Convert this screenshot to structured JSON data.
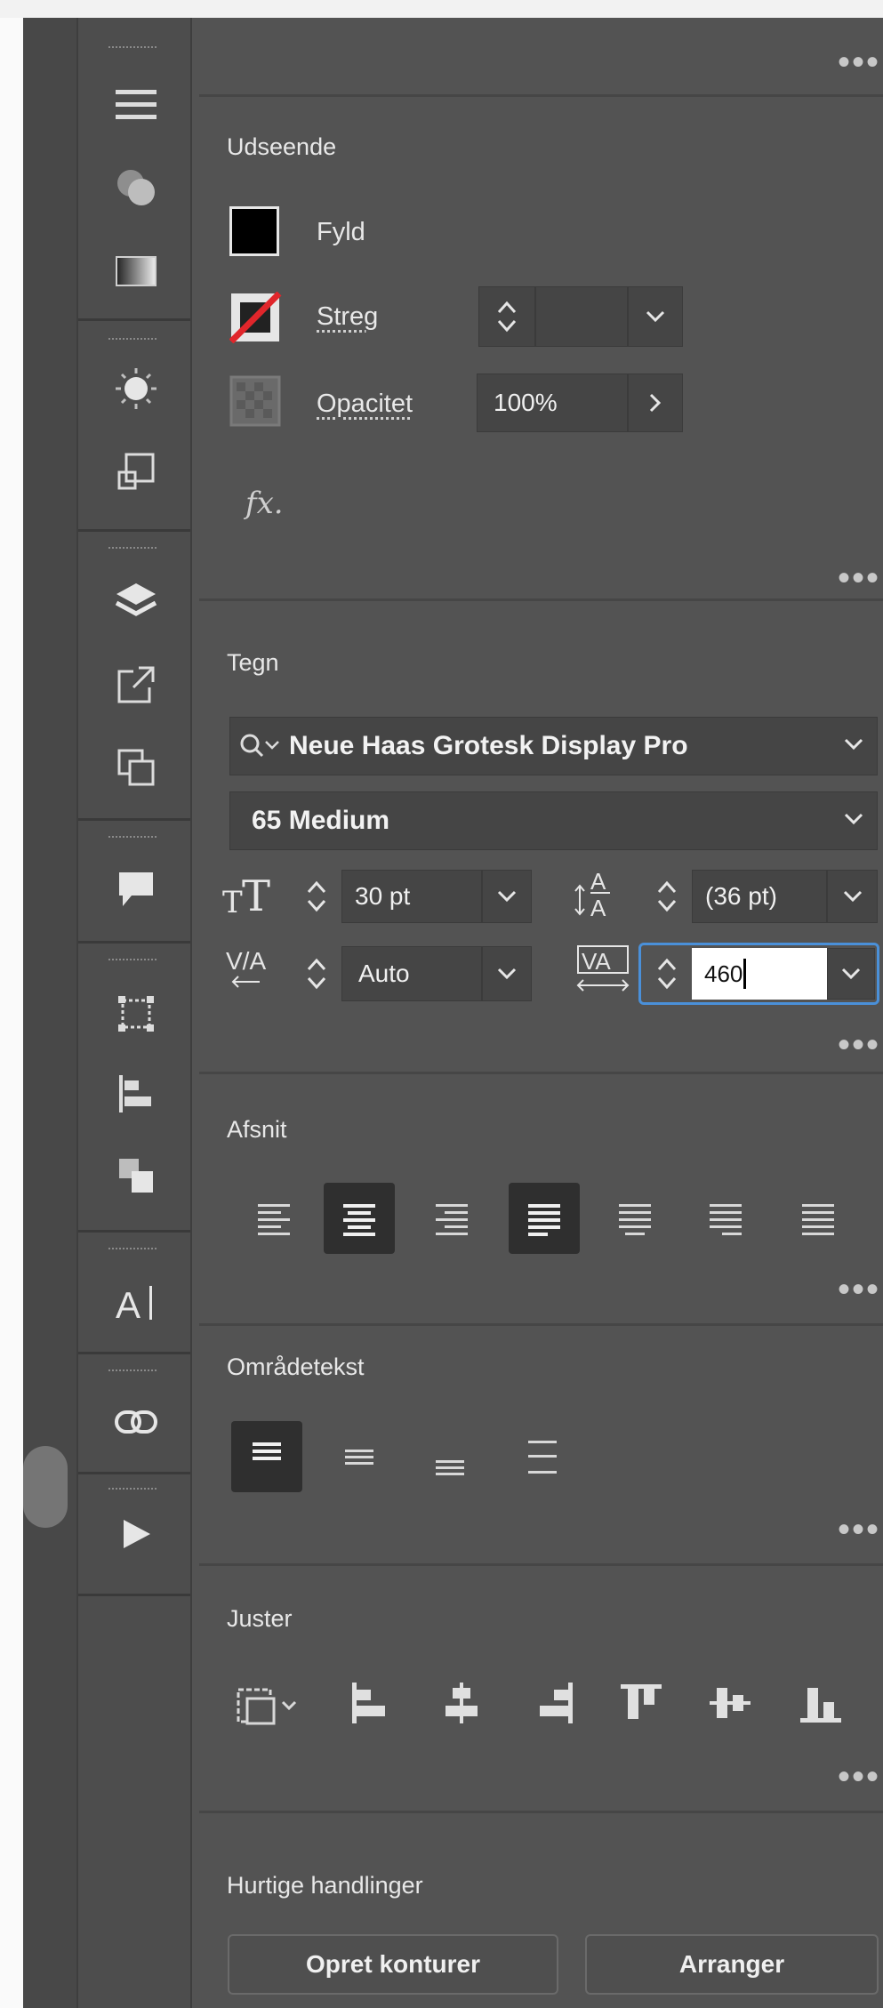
{
  "appearance": {
    "title": "Udseende",
    "fill_label": "Fyld",
    "stroke_label": "Streg",
    "stroke_value": "",
    "opacity_label": "Opacitet",
    "opacity_value": "100%",
    "fx_label": "fx."
  },
  "character": {
    "title": "Tegn",
    "font_family": "Neue Haas Grotesk Display Pro",
    "font_style": "65 Medium",
    "font_size": "30 pt",
    "leading": "(36 pt)",
    "kerning": "Auto",
    "tracking": "460"
  },
  "paragraph": {
    "title": "Afsnit"
  },
  "area_type": {
    "title": "Områdetekst"
  },
  "align": {
    "title": "Juster"
  },
  "quick_actions": {
    "title": "Hurtige handlinger",
    "create_outlines": "Opret konturer",
    "arrange": "Arranger"
  },
  "colors": {
    "panel_bg": "#535353",
    "toolbar_bg": "#4d4d4d",
    "focus_border": "#4a90d9",
    "stroke_none": "#e0262b"
  },
  "more_glyph": "•••"
}
